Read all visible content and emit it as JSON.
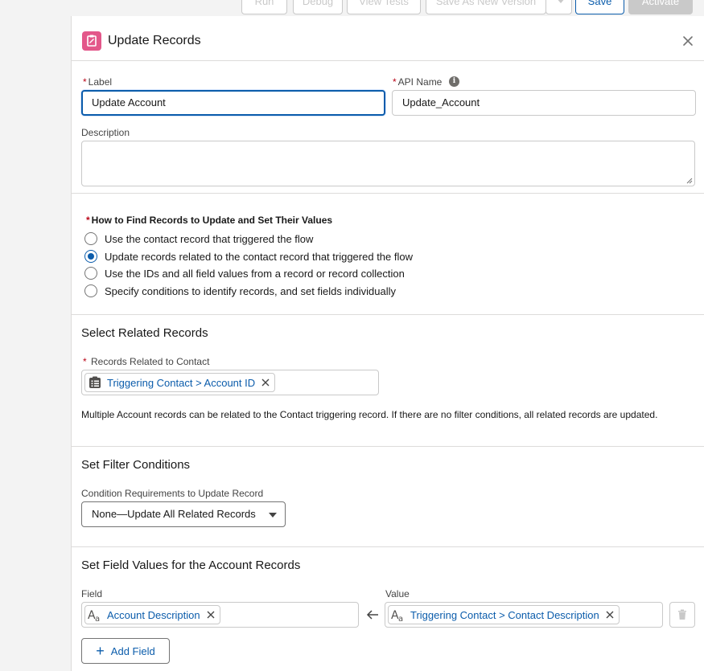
{
  "toolbar": {
    "run": "Run",
    "debug": "Debug",
    "view_tests": "View Tests",
    "save_as": "Save As New Version",
    "save": "Save",
    "activate": "Activate"
  },
  "panel": {
    "title": "Update Records",
    "label_caption": "Label",
    "label_value": "Update Account",
    "api_caption": "API Name",
    "api_value": "Update_Account",
    "description_caption": "Description",
    "description_value": ""
  },
  "how_to": {
    "title": "How to Find Records to Update and Set Their Values",
    "options": [
      "Use the contact record that triggered the flow",
      "Update records related to the contact record that triggered the flow",
      "Use the IDs and all field values from a record or record collection",
      "Specify conditions to identify records, and set fields individually"
    ],
    "selected_index": 1
  },
  "related": {
    "title": "Select Related Records",
    "field_caption": "Records Related to Contact",
    "pill": "Triggering Contact > Account ID",
    "help": "Multiple Account records can be related to the Contact triggering record. If there are no filter conditions, all related records are updated."
  },
  "filter": {
    "title": "Set Filter Conditions",
    "caption": "Condition Requirements to Update Record",
    "selected": "None—Update All Related Records"
  },
  "field_values": {
    "title": "Set Field Values for the Account Records",
    "field_caption": "Field",
    "value_caption": "Value",
    "field_pill": "Account Description",
    "value_pill": "Triggering Contact > Contact Description",
    "add_field": "Add Field"
  },
  "colors": {
    "accent": "#0b5cab",
    "header_icon": "#e3578a",
    "required": "#ba0517"
  }
}
